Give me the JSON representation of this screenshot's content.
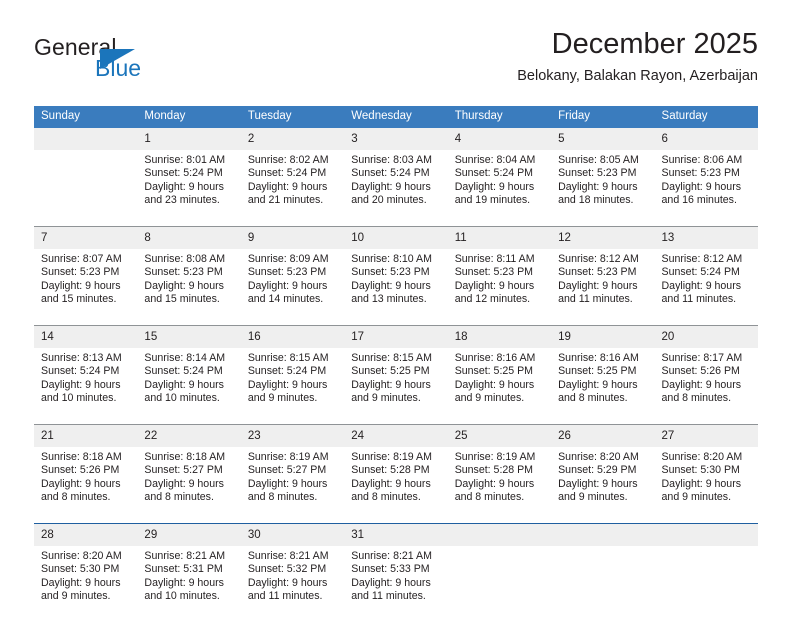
{
  "brand": {
    "name_part1": "General",
    "name_part2": "Blue",
    "accent_color": "#1b75bb",
    "triangle_icon": "triangle-icon"
  },
  "header": {
    "title": "December 2025",
    "subtitle": "Belokany, Balakan Rayon, Azerbaijan"
  },
  "calendar": {
    "header_bg": "#3a7cbe",
    "daynum_bg": "#efefef",
    "weekday_headers": [
      "Sunday",
      "Monday",
      "Tuesday",
      "Wednesday",
      "Thursday",
      "Friday",
      "Saturday"
    ],
    "weeks": [
      {
        "separator": "none",
        "days": [
          {
            "day": "",
            "sunrise": "",
            "sunset": "",
            "daylight_line1": "",
            "daylight_line2": ""
          },
          {
            "day": "1",
            "sunrise": "Sunrise: 8:01 AM",
            "sunset": "Sunset: 5:24 PM",
            "daylight_line1": "Daylight: 9 hours",
            "daylight_line2": "and 23 minutes."
          },
          {
            "day": "2",
            "sunrise": "Sunrise: 8:02 AM",
            "sunset": "Sunset: 5:24 PM",
            "daylight_line1": "Daylight: 9 hours",
            "daylight_line2": "and 21 minutes."
          },
          {
            "day": "3",
            "sunrise": "Sunrise: 8:03 AM",
            "sunset": "Sunset: 5:24 PM",
            "daylight_line1": "Daylight: 9 hours",
            "daylight_line2": "and 20 minutes."
          },
          {
            "day": "4",
            "sunrise": "Sunrise: 8:04 AM",
            "sunset": "Sunset: 5:24 PM",
            "daylight_line1": "Daylight: 9 hours",
            "daylight_line2": "and 19 minutes."
          },
          {
            "day": "5",
            "sunrise": "Sunrise: 8:05 AM",
            "sunset": "Sunset: 5:23 PM",
            "daylight_line1": "Daylight: 9 hours",
            "daylight_line2": "and 18 minutes."
          },
          {
            "day": "6",
            "sunrise": "Sunrise: 8:06 AM",
            "sunset": "Sunset: 5:23 PM",
            "daylight_line1": "Daylight: 9 hours",
            "daylight_line2": "and 16 minutes."
          }
        ]
      },
      {
        "separator": "gray",
        "days": [
          {
            "day": "7",
            "sunrise": "Sunrise: 8:07 AM",
            "sunset": "Sunset: 5:23 PM",
            "daylight_line1": "Daylight: 9 hours",
            "daylight_line2": "and 15 minutes."
          },
          {
            "day": "8",
            "sunrise": "Sunrise: 8:08 AM",
            "sunset": "Sunset: 5:23 PM",
            "daylight_line1": "Daylight: 9 hours",
            "daylight_line2": "and 15 minutes."
          },
          {
            "day": "9",
            "sunrise": "Sunrise: 8:09 AM",
            "sunset": "Sunset: 5:23 PM",
            "daylight_line1": "Daylight: 9 hours",
            "daylight_line2": "and 14 minutes."
          },
          {
            "day": "10",
            "sunrise": "Sunrise: 8:10 AM",
            "sunset": "Sunset: 5:23 PM",
            "daylight_line1": "Daylight: 9 hours",
            "daylight_line2": "and 13 minutes."
          },
          {
            "day": "11",
            "sunrise": "Sunrise: 8:11 AM",
            "sunset": "Sunset: 5:23 PM",
            "daylight_line1": "Daylight: 9 hours",
            "daylight_line2": "and 12 minutes."
          },
          {
            "day": "12",
            "sunrise": "Sunrise: 8:12 AM",
            "sunset": "Sunset: 5:23 PM",
            "daylight_line1": "Daylight: 9 hours",
            "daylight_line2": "and 11 minutes."
          },
          {
            "day": "13",
            "sunrise": "Sunrise: 8:12 AM",
            "sunset": "Sunset: 5:24 PM",
            "daylight_line1": "Daylight: 9 hours",
            "daylight_line2": "and 11 minutes."
          }
        ]
      },
      {
        "separator": "gray",
        "days": [
          {
            "day": "14",
            "sunrise": "Sunrise: 8:13 AM",
            "sunset": "Sunset: 5:24 PM",
            "daylight_line1": "Daylight: 9 hours",
            "daylight_line2": "and 10 minutes."
          },
          {
            "day": "15",
            "sunrise": "Sunrise: 8:14 AM",
            "sunset": "Sunset: 5:24 PM",
            "daylight_line1": "Daylight: 9 hours",
            "daylight_line2": "and 10 minutes."
          },
          {
            "day": "16",
            "sunrise": "Sunrise: 8:15 AM",
            "sunset": "Sunset: 5:24 PM",
            "daylight_line1": "Daylight: 9 hours",
            "daylight_line2": "and 9 minutes."
          },
          {
            "day": "17",
            "sunrise": "Sunrise: 8:15 AM",
            "sunset": "Sunset: 5:25 PM",
            "daylight_line1": "Daylight: 9 hours",
            "daylight_line2": "and 9 minutes."
          },
          {
            "day": "18",
            "sunrise": "Sunrise: 8:16 AM",
            "sunset": "Sunset: 5:25 PM",
            "daylight_line1": "Daylight: 9 hours",
            "daylight_line2": "and 9 minutes."
          },
          {
            "day": "19",
            "sunrise": "Sunrise: 8:16 AM",
            "sunset": "Sunset: 5:25 PM",
            "daylight_line1": "Daylight: 9 hours",
            "daylight_line2": "and 8 minutes."
          },
          {
            "day": "20",
            "sunrise": "Sunrise: 8:17 AM",
            "sunset": "Sunset: 5:26 PM",
            "daylight_line1": "Daylight: 9 hours",
            "daylight_line2": "and 8 minutes."
          }
        ]
      },
      {
        "separator": "gray",
        "days": [
          {
            "day": "21",
            "sunrise": "Sunrise: 8:18 AM",
            "sunset": "Sunset: 5:26 PM",
            "daylight_line1": "Daylight: 9 hours",
            "daylight_line2": "and 8 minutes."
          },
          {
            "day": "22",
            "sunrise": "Sunrise: 8:18 AM",
            "sunset": "Sunset: 5:27 PM",
            "daylight_line1": "Daylight: 9 hours",
            "daylight_line2": "and 8 minutes."
          },
          {
            "day": "23",
            "sunrise": "Sunrise: 8:19 AM",
            "sunset": "Sunset: 5:27 PM",
            "daylight_line1": "Daylight: 9 hours",
            "daylight_line2": "and 8 minutes."
          },
          {
            "day": "24",
            "sunrise": "Sunrise: 8:19 AM",
            "sunset": "Sunset: 5:28 PM",
            "daylight_line1": "Daylight: 9 hours",
            "daylight_line2": "and 8 minutes."
          },
          {
            "day": "25",
            "sunrise": "Sunrise: 8:19 AM",
            "sunset": "Sunset: 5:28 PM",
            "daylight_line1": "Daylight: 9 hours",
            "daylight_line2": "and 8 minutes."
          },
          {
            "day": "26",
            "sunrise": "Sunrise: 8:20 AM",
            "sunset": "Sunset: 5:29 PM",
            "daylight_line1": "Daylight: 9 hours",
            "daylight_line2": "and 9 minutes."
          },
          {
            "day": "27",
            "sunrise": "Sunrise: 8:20 AM",
            "sunset": "Sunset: 5:30 PM",
            "daylight_line1": "Daylight: 9 hours",
            "daylight_line2": "and 9 minutes."
          }
        ]
      },
      {
        "separator": "blue",
        "days": [
          {
            "day": "28",
            "sunrise": "Sunrise: 8:20 AM",
            "sunset": "Sunset: 5:30 PM",
            "daylight_line1": "Daylight: 9 hours",
            "daylight_line2": "and 9 minutes."
          },
          {
            "day": "29",
            "sunrise": "Sunrise: 8:21 AM",
            "sunset": "Sunset: 5:31 PM",
            "daylight_line1": "Daylight: 9 hours",
            "daylight_line2": "and 10 minutes."
          },
          {
            "day": "30",
            "sunrise": "Sunrise: 8:21 AM",
            "sunset": "Sunset: 5:32 PM",
            "daylight_line1": "Daylight: 9 hours",
            "daylight_line2": "and 11 minutes."
          },
          {
            "day": "31",
            "sunrise": "Sunrise: 8:21 AM",
            "sunset": "Sunset: 5:33 PM",
            "daylight_line1": "Daylight: 9 hours",
            "daylight_line2": "and 11 minutes."
          },
          {
            "day": "",
            "sunrise": "",
            "sunset": "",
            "daylight_line1": "",
            "daylight_line2": ""
          },
          {
            "day": "",
            "sunrise": "",
            "sunset": "",
            "daylight_line1": "",
            "daylight_line2": ""
          },
          {
            "day": "",
            "sunrise": "",
            "sunset": "",
            "daylight_line1": "",
            "daylight_line2": ""
          }
        ]
      }
    ]
  }
}
